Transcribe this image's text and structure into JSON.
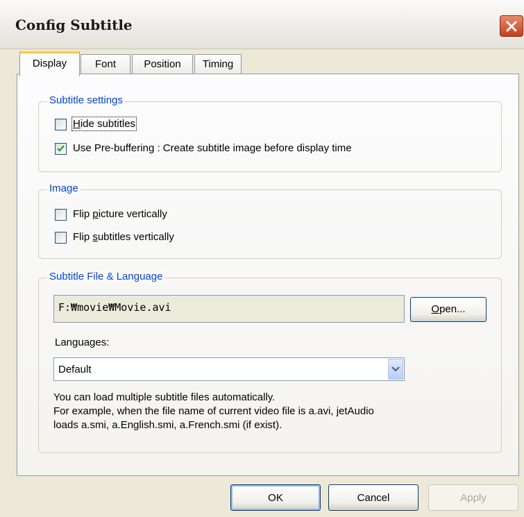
{
  "window": {
    "title": "Config Subtitle"
  },
  "tabs": [
    {
      "label": "Display",
      "active": true
    },
    {
      "label": "Font",
      "active": false
    },
    {
      "label": "Position",
      "active": false
    },
    {
      "label": "Timing",
      "active": false
    }
  ],
  "subtitle_settings": {
    "legend": "Subtitle settings",
    "hide_subtitles": {
      "mnemonic": "H",
      "rest": "ide subtitles",
      "checked": false
    },
    "prebuffering": {
      "label": "Use Pre-buffering : Create subtitle image before display time",
      "checked": true
    }
  },
  "image": {
    "legend": "Image",
    "flip_picture": {
      "pre": "Flip ",
      "mnemonic": "p",
      "rest": "icture vertically",
      "checked": false
    },
    "flip_subtitles": {
      "pre": "Flip ",
      "mnemonic": "s",
      "rest": "ubtitles vertically",
      "checked": false
    }
  },
  "file_language": {
    "legend": "Subtitle File & Language",
    "file_path": "F:₩movie₩Movie.avi",
    "open_button": {
      "mnemonic": "O",
      "rest": "pen..."
    },
    "languages_label": "Languages:",
    "selected_language": "Default",
    "info_lines": [
      "You can load multiple subtitle files automatically.",
      "For example, when the file name of current video file is a.avi, jetAudio",
      "loads a.smi, a.English.smi, a.French.smi (if exist)."
    ]
  },
  "buttons": {
    "ok": "OK",
    "cancel": "Cancel",
    "apply": "Apply"
  },
  "colors": {
    "legend": "#0046d5",
    "tab_highlight": "#ffc83c",
    "close": "#c3401c"
  }
}
